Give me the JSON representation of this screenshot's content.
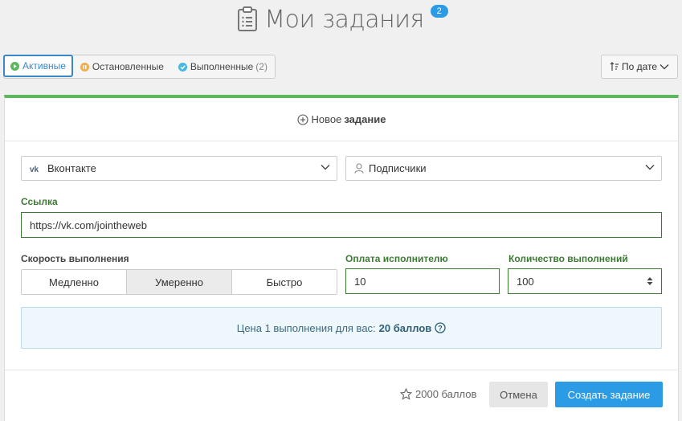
{
  "header": {
    "title": "Мои задания",
    "badge": "2"
  },
  "filters": {
    "active_label": "Активные",
    "stopped_label": "Остановленные",
    "done_label": "Выполненные",
    "done_count": "(2)"
  },
  "sort": {
    "label": "По дате"
  },
  "card": {
    "new_task_prefix": "Новое",
    "new_task_bold": "задание",
    "network_select": "Вконтакте",
    "type_select": "Подписчики",
    "link_label": "Ссылка",
    "link_value": "https://vk.com/jointheweb",
    "speed_label": "Скорость выполнения",
    "speed_options": [
      "Медленно",
      "Умеренно",
      "Быстро"
    ],
    "speed_selected": "Умеренно",
    "pay_label": "Оплата исполнителю",
    "pay_value": "10",
    "count_label": "Количество выполнений",
    "count_value": "100",
    "price_text": "Цена 1 выполнения для вас:",
    "price_value": "20 баллов"
  },
  "footer": {
    "balance": "2000 баллов",
    "cancel_label": "Отмена",
    "create_label": "Создать задание"
  },
  "colors": {
    "accent_blue": "#2c9be6",
    "success_green": "#5cb85c",
    "label_green": "#3c7a33",
    "paused_orange": "#f0ad4e"
  }
}
